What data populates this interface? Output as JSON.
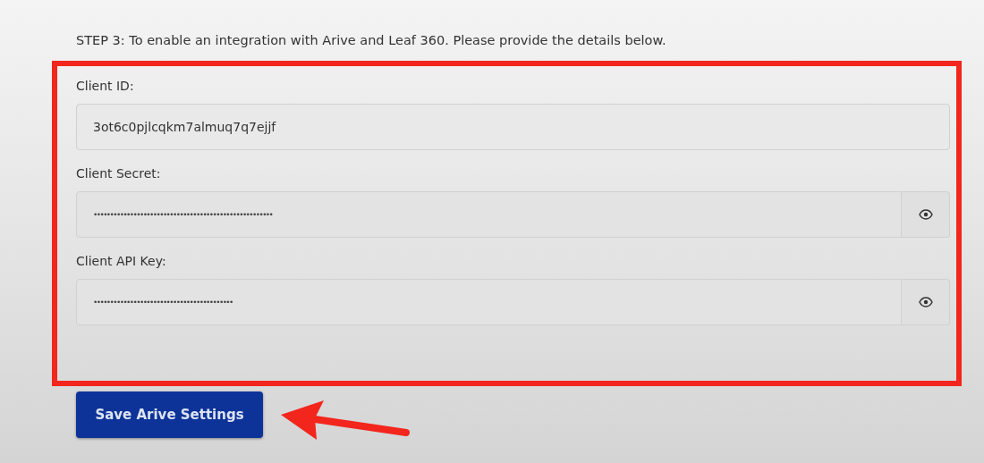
{
  "instructions": "STEP 3: To enable an integration with Arive and Leaf 360. Please provide the details below.",
  "fields": [
    {
      "label": "Client ID:",
      "value": "3ot6c0pjlcqkm7almuq7q7ejjf",
      "kind": "text"
    },
    {
      "label": "Client Secret:",
      "value": "••••••••••••••••••••••••••••••••••••••••••••••••••••••",
      "kind": "secret"
    },
    {
      "label": "Client API Key:",
      "value": "••••••••••••••••••••••••••••••••••••••••••",
      "kind": "secret"
    }
  ],
  "save_button": {
    "label": "Save Arive Settings"
  },
  "annotation": {
    "frame": true,
    "arrow": true
  }
}
